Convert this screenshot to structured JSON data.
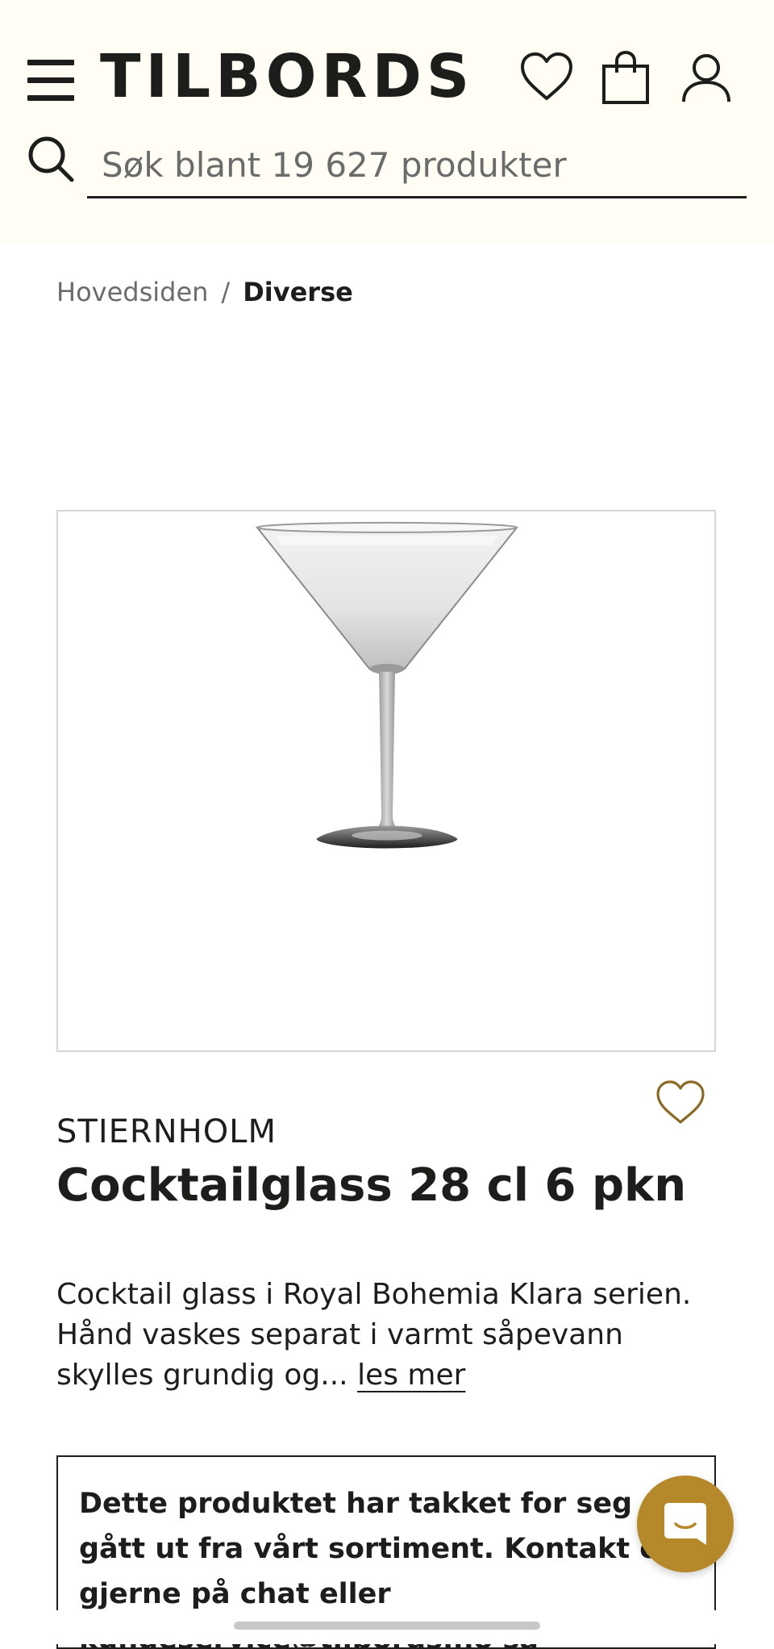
{
  "header": {
    "logo": "TILBORDS",
    "menu_icon": "hamburger-menu-icon",
    "icons": [
      "heart-icon",
      "shopping-bag-icon",
      "user-icon"
    ],
    "search": {
      "icon": "search-icon",
      "placeholder": "Søk blant 19 627 produkter",
      "value": ""
    }
  },
  "breadcrumb": {
    "items": [
      "Hovedsiden",
      "Diverse"
    ],
    "separator": "/"
  },
  "product": {
    "image_alt": "cocktail-glass",
    "brand": "STIERNHOLM",
    "title": "Cocktailglass 28 cl 6 pkn",
    "description": "Cocktail glass i Royal Bohemia Klara serien. Hånd vaskes separat i varmt såpevann skylles grundig og... ",
    "read_more": "les mer",
    "wishlist_icon": "heart-outline-icon"
  },
  "notice": {
    "text": "Dette produktet har takket for seg og gått ut fra vårt sortiment. Kontakt oss gjerne på chat eller kundeservice@tilbords.no så"
  },
  "chat": {
    "icon": "chat-bubble-icon"
  },
  "colors": {
    "header_bg": "#fffdf4",
    "text": "#1d1d1b",
    "muted": "#6b6b6b",
    "accent_gold": "#b5892a",
    "border": "#d6d6d6"
  }
}
